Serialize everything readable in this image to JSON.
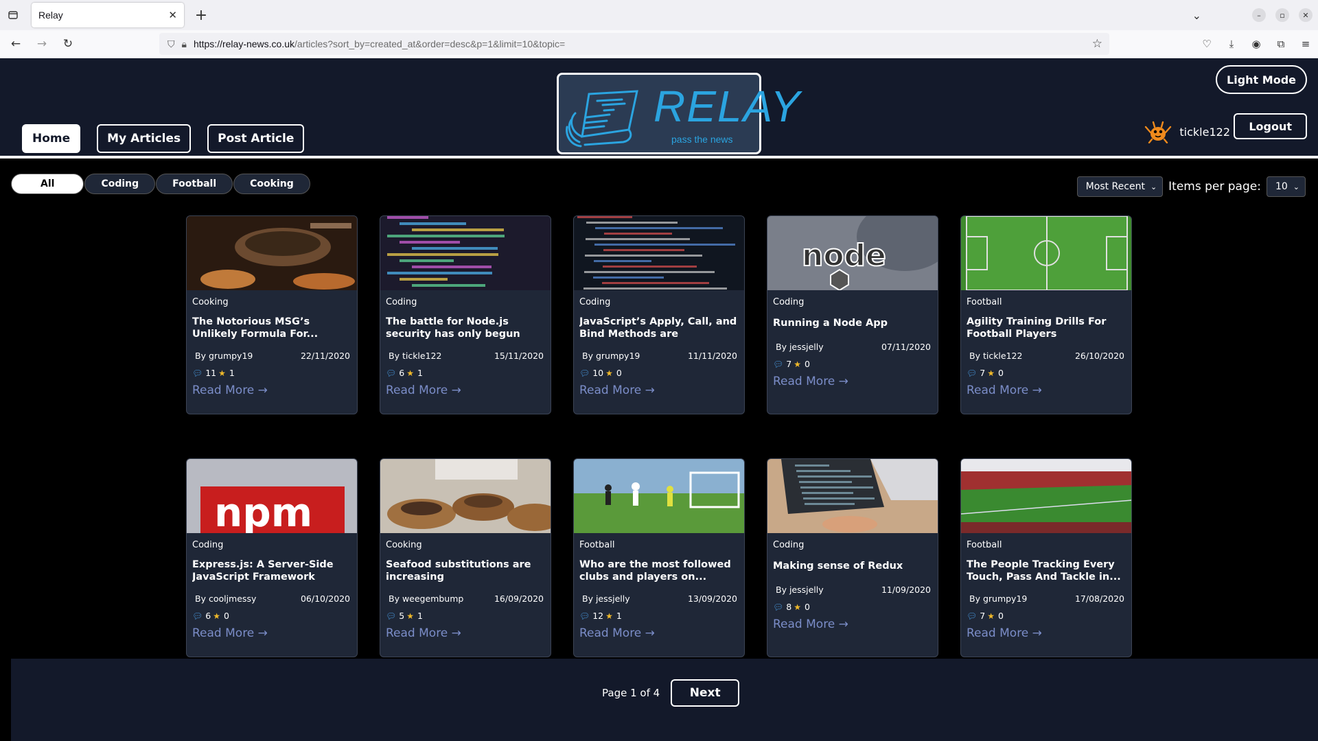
{
  "browser": {
    "tab_title": "Relay",
    "url_host": "https://relay-news.co.uk",
    "url_path": "/articles?sort_by=created_at&order=desc&p=1&limit=10&topic="
  },
  "header": {
    "nav": {
      "home": "Home",
      "my_articles": "My Articles",
      "post_article": "Post Article"
    },
    "logo_text": "RELAY",
    "logo_tagline": "pass the news",
    "light_mode_label": "Light Mode",
    "username": "tickle122",
    "logout_label": "Logout"
  },
  "filters": {
    "topics": [
      "All",
      "Coding",
      "Football",
      "Cooking"
    ],
    "active_topic": "All",
    "sort_value": "Most Recent",
    "items_per_page_label": "Items per page:",
    "items_per_page_value": "10"
  },
  "articles": [
    {
      "topic": "Cooking",
      "title": "The Notorious MSG’s Unlikely Formula For...",
      "author": "By grumpy19",
      "date": "22/11/2020",
      "comments": "11",
      "votes": "1",
      "read_more": "Read More →",
      "thumb": "cooking-pan"
    },
    {
      "topic": "Coding",
      "title": "The battle for Node.js security has only begun",
      "author": "By tickle122",
      "date": "15/11/2020",
      "comments": "6",
      "votes": "1",
      "read_more": "Read More →",
      "thumb": "code-screen"
    },
    {
      "topic": "Coding",
      "title": "JavaScript’s Apply, Call, and Bind Methods are Essentia...",
      "author": "By grumpy19",
      "date": "11/11/2020",
      "comments": "10",
      "votes": "0",
      "read_more": "Read More →",
      "thumb": "code-dark"
    },
    {
      "topic": "Coding",
      "title": "Running a Node App",
      "author": "By jessjelly",
      "date": "07/11/2020",
      "comments": "7",
      "votes": "0",
      "read_more": "Read More →",
      "thumb": "node-logo"
    },
    {
      "topic": "Football",
      "title": "Agility Training Drills For Football Players",
      "author": "By tickle122",
      "date": "26/10/2020",
      "comments": "7",
      "votes": "0",
      "read_more": "Read More →",
      "thumb": "pitch-aerial"
    },
    {
      "topic": "Coding",
      "title": "Express.js: A Server-Side JavaScript Framework",
      "author": "By cooljmessy",
      "date": "06/10/2020",
      "comments": "6",
      "votes": "0",
      "read_more": "Read More →",
      "thumb": "npm-logo"
    },
    {
      "topic": "Cooking",
      "title": "Seafood substitutions are increasing",
      "author": "By weegembump",
      "date": "16/09/2020",
      "comments": "5",
      "votes": "1",
      "read_more": "Read More →",
      "thumb": "seafood"
    },
    {
      "topic": "Football",
      "title": "Who are the most followed clubs and players on...",
      "author": "By jessjelly",
      "date": "13/09/2020",
      "comments": "12",
      "votes": "1",
      "read_more": "Read More →",
      "thumb": "football-match"
    },
    {
      "topic": "Coding",
      "title": "Making sense of Redux",
      "author": "By jessjelly",
      "date": "11/09/2020",
      "comments": "8",
      "votes": "0",
      "read_more": "Read More →",
      "thumb": "laptop"
    },
    {
      "topic": "Football",
      "title": "The People Tracking Every Touch, Pass And Tackle in...",
      "author": "By grumpy19",
      "date": "17/08/2020",
      "comments": "7",
      "votes": "0",
      "read_more": "Read More →",
      "thumb": "stadium"
    }
  ],
  "pagination": {
    "label": "Page 1 of 4",
    "next_label": "Next"
  }
}
